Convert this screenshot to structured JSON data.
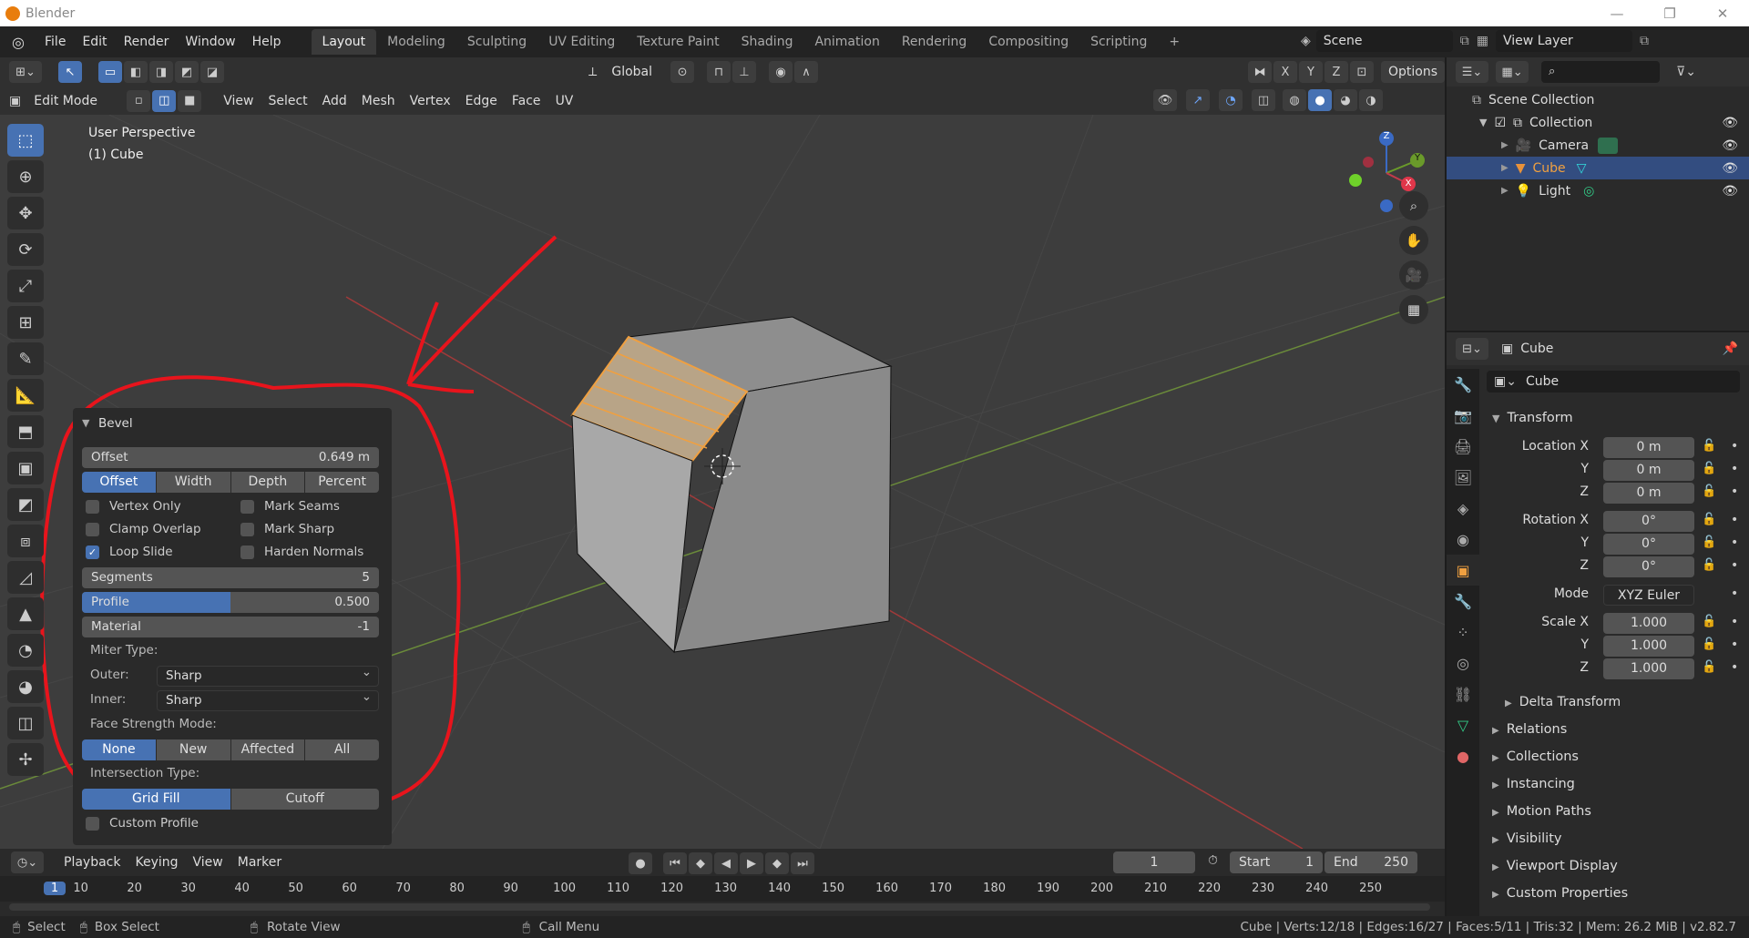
{
  "window": {
    "title": "Blender",
    "controls": [
      "—",
      "❐",
      "✕"
    ]
  },
  "menu": [
    "File",
    "Edit",
    "Render",
    "Window",
    "Help"
  ],
  "workspaces": [
    "Layout",
    "Modeling",
    "Sculpting",
    "UV Editing",
    "Texture Paint",
    "Shading",
    "Animation",
    "Rendering",
    "Compositing",
    "Scripting",
    "+"
  ],
  "active_workspace": "Layout",
  "scene": "Scene",
  "view_layer": "View Layer",
  "header": {
    "transform": "Global",
    "options": "Options",
    "mode": "Edit Mode",
    "menus": [
      "View",
      "Select",
      "Add",
      "Mesh",
      "Vertex",
      "Edge",
      "Face",
      "UV"
    ],
    "axes": [
      "X",
      "Y",
      "Z"
    ]
  },
  "viewport": {
    "perspective": "User Perspective",
    "object": "(1) Cube"
  },
  "gizmo": {
    "x": "X",
    "y": "Y",
    "z": "Z"
  },
  "bevel": {
    "title": "Bevel",
    "offset_label": "Offset",
    "offset_value": "0.649 m",
    "width_types": [
      "Offset",
      "Width",
      "Depth",
      "Percent"
    ],
    "active_width_type": "Offset",
    "checks": {
      "vertex_only": "Vertex Only",
      "mark_seams": "Mark Seams",
      "clamp_overlap": "Clamp Overlap",
      "mark_sharp": "Mark Sharp",
      "loop_slide": "Loop Slide",
      "harden_normals": "Harden Normals",
      "custom_profile": "Custom Profile"
    },
    "loop_slide_checked": true,
    "segments_label": "Segments",
    "segments_value": "5",
    "profile_label": "Profile",
    "profile_value": "0.500",
    "profile_fraction": 0.5,
    "material_label": "Material",
    "material_value": "-1",
    "miter_type": "Miter Type:",
    "outer_label": "Outer:",
    "outer_value": "Sharp",
    "inner_label": "Inner:",
    "inner_value": "Sharp",
    "face_strength": "Face Strength Mode:",
    "face_strength_options": [
      "None",
      "New",
      "Affected",
      "All"
    ],
    "intersection": "Intersection Type:",
    "intersection_options": [
      "Grid Fill",
      "Cutoff"
    ]
  },
  "timeline": {
    "menus": [
      "Playback",
      "Keying",
      "View",
      "Marker"
    ],
    "current_frame": "1",
    "start_label": "Start",
    "start": "1",
    "end_label": "End",
    "end": "250",
    "ticks": [
      "1",
      "10",
      "20",
      "30",
      "40",
      "50",
      "60",
      "70",
      "80",
      "90",
      "100",
      "110",
      "120",
      "130",
      "140",
      "150",
      "160",
      "170",
      "180",
      "190",
      "200",
      "210",
      "220",
      "230",
      "240",
      "250"
    ]
  },
  "status": {
    "select": "Select",
    "box_select": "Box Select",
    "rotate_view": "Rotate View",
    "call_menu": "Call Menu",
    "stats": "Cube | Verts:12/18 | Edges:16/27 | Faces:5/11 | Tris:32 | Mem: 26.2 MiB | v2.82.7"
  },
  "outliner": {
    "root": "Scene Collection",
    "collection": "Collection",
    "items": [
      "Camera",
      "Cube",
      "Light"
    ],
    "selected": "Cube"
  },
  "properties": {
    "object": "Cube",
    "name": "Cube",
    "transform": "Transform",
    "location_label": "Location X",
    "location": [
      "0 m",
      "0 m",
      "0 m"
    ],
    "rotation_label": "Rotation X",
    "rotation": [
      "0°",
      "0°",
      "0°"
    ],
    "mode_label": "Mode",
    "mode": "XYZ Euler",
    "scale_label": "Scale X",
    "scale": [
      "1.000",
      "1.000",
      "1.000"
    ],
    "y": "Y",
    "z": "Z",
    "delta": "Delta Transform",
    "panels": [
      "Relations",
      "Collections",
      "Instancing",
      "Motion Paths",
      "Visibility",
      "Viewport Display",
      "Custom Properties"
    ]
  },
  "colors": {
    "accent": "#4772b3",
    "annotation": "#e8141c",
    "selection": "#f0a040"
  }
}
